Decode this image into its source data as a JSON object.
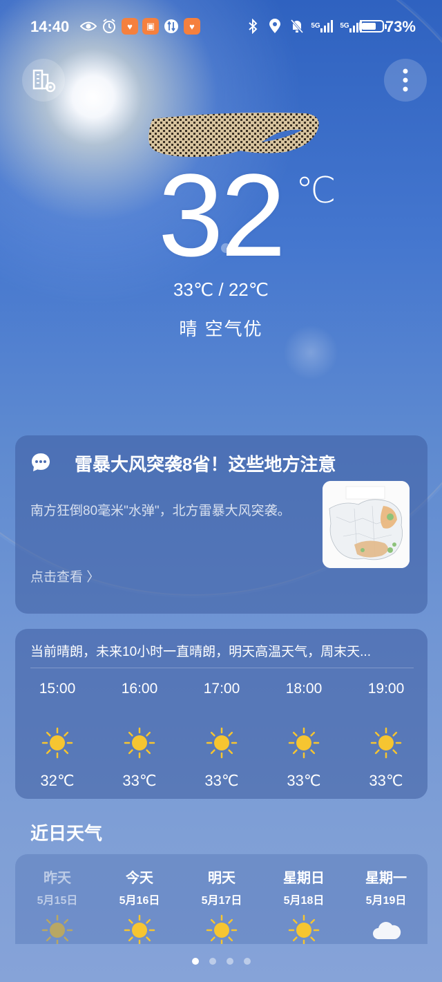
{
  "status_bar": {
    "time": "14:40",
    "net1": "5G",
    "net2": "5G",
    "battery_percent": "73%",
    "battery_level": 0.73
  },
  "weather": {
    "current_temp": "32",
    "unit": "℃",
    "range": "33℃ / 22℃",
    "condition": "晴  空气优"
  },
  "news": {
    "title": "雷暴大风突袭8省！这些地方注意",
    "description": "南方狂倒80毫米\"水弹\"，北方雷暴大风突袭。",
    "link": "点击查看 〉"
  },
  "hourly": {
    "summary": "当前晴朗，未来10小时一直晴朗，明天高温天气，周末天...",
    "items": [
      {
        "time": "15:00",
        "icon": "sun-icon",
        "temp": "32℃"
      },
      {
        "time": "16:00",
        "icon": "sun-icon",
        "temp": "33℃"
      },
      {
        "time": "17:00",
        "icon": "sun-icon",
        "temp": "33℃"
      },
      {
        "time": "18:00",
        "icon": "sun-icon",
        "temp": "33℃"
      },
      {
        "time": "19:00",
        "icon": "sun-icon",
        "temp": "33℃"
      }
    ]
  },
  "recent": {
    "title": "近日天气",
    "days": [
      {
        "name": "昨天",
        "date": "5月15日",
        "icon": "sun-icon"
      },
      {
        "name": "今天",
        "date": "5月16日",
        "icon": "sun-icon"
      },
      {
        "name": "明天",
        "date": "5月17日",
        "icon": "sun-icon"
      },
      {
        "name": "星期日",
        "date": "5月18日",
        "icon": "sun-icon"
      },
      {
        "name": "星期一",
        "date": "5月19日",
        "icon": "cloud-icon"
      }
    ]
  },
  "pager": {
    "count": 4,
    "active": 0
  },
  "colors": {
    "sun": "#f6c531",
    "sun_past": "#b8a764",
    "card": "#3e5ca0"
  }
}
